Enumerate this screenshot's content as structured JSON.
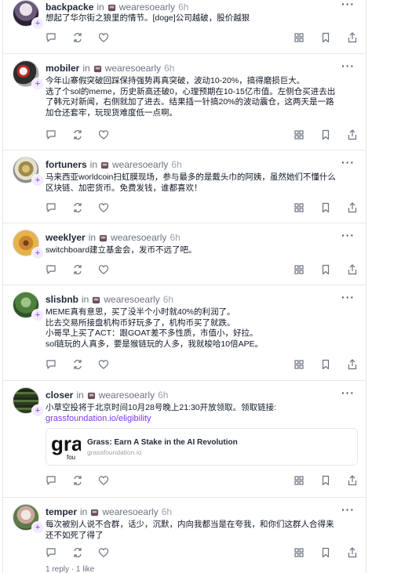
{
  "colors": {
    "accent": "#7c3aed",
    "border": "#e5e7eb",
    "muted": "#6b7280",
    "icon": "#6b7280"
  },
  "icons": [
    "reply-icon",
    "repost-icon",
    "heart-icon",
    "grid-icon",
    "bookmark-icon",
    "share-icon",
    "more-icon",
    "channel-icon",
    "plus-icon"
  ],
  "posts": [
    {
      "username": "backpacke",
      "in": "in",
      "channel": "wearesoearly",
      "time": "6h",
      "lines": [
        "想起了华尔街之狼里的情节。[doge]公司越破，股价越狠"
      ]
    },
    {
      "username": "mobiler",
      "in": "in",
      "channel": "wearesoearly",
      "time": "6h",
      "lines": [
        "今年山寨假突破回踩保持强势再真突破，波动10-20%，搞得磨损巨大。",
        "选了个sol的meme，历史新高还破0，心理预期在10-15亿市值。左侧仓买进去出",
        "了韩元对新闻，右侧就加了进去。结果插一针搞20%的波动震仓，这两天是一路",
        "加仓还套牢，玩现货难度低一点啊。"
      ]
    },
    {
      "username": "fortuners",
      "in": "in",
      "channel": "wearesoearly",
      "time": "6h",
      "lines": [
        "马来西亚worldcoin扫虹膜现场，参与最多的是戴头巾的阿姨，虽然她们不懂什么",
        "区块链、加密货币。免费发钱，谁都喜欢！"
      ]
    },
    {
      "username": "weeklyer",
      "in": "in",
      "channel": "wearesoearly",
      "time": "6h",
      "lines": [
        "switchboard建立基金会，发币不远了吧。"
      ]
    },
    {
      "username": "slisbnb",
      "in": "in",
      "channel": "wearesoearly",
      "time": "6h",
      "lines": [
        "MEME真有意思，买了没半个小时就40%的利润了。",
        "比去交易所接盘机构币好玩多了，机构币买了就跌。",
        "小哥早上买了ACT：跟GOAT差不多性质，市值小，好拉。",
        "sol链玩的人真多，要是猴链玩的人多，我就梭哈10倍APE。"
      ]
    },
    {
      "username": "closer",
      "in": "in",
      "channel": "wearesoearly",
      "time": "6h",
      "lines": [
        "小草空投将于北京时间10月28号晚上21:30开放领取。领取链接:"
      ],
      "link": "grassfoundation.io/eligibility",
      "card": {
        "title": "Grass: Earn A Stake in the AI Revolution",
        "domain": "grassfoundation.io",
        "thumb_big": "gra",
        "thumb_small": "fou"
      }
    },
    {
      "username": "temper",
      "in": "in",
      "channel": "wearesoearly",
      "time": "6h",
      "lines": [
        "每次被别人说不合群，话少，沉默，内向我都当是在夸我，和你们这群人合得来",
        "还不如死了得了"
      ],
      "stats": "1 reply · 1 like"
    }
  ]
}
